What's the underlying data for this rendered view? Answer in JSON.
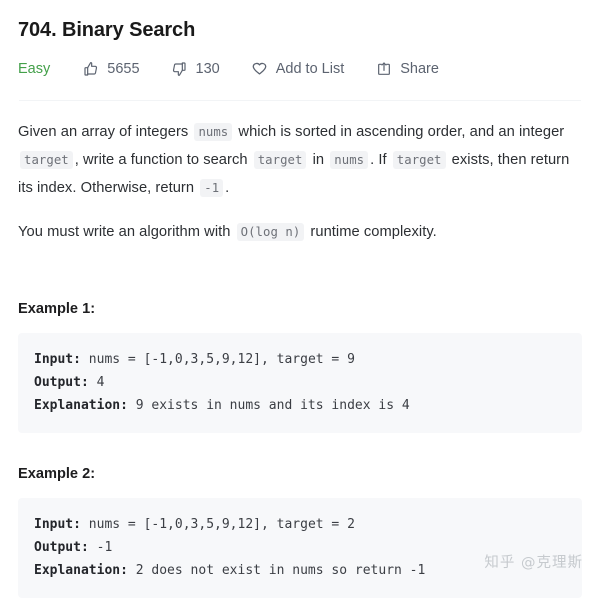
{
  "problem": {
    "title": "704. Binary Search",
    "difficulty": "Easy",
    "difficulty_color": "#44a04a"
  },
  "actions": [
    {
      "icon": "thumbs-up-icon",
      "label": "5655"
    },
    {
      "icon": "thumbs-down-icon",
      "label": "130"
    },
    {
      "icon": "heart-icon",
      "label": "Add to List"
    },
    {
      "icon": "share-icon",
      "label": "Share"
    }
  ],
  "description": {
    "p1": {
      "t1": "Given an array of integers",
      "c1": "nums",
      "t2": "which is sorted in ascending order, and an integer",
      "c2": "target",
      "t3": ", write a function to search",
      "c3": "target",
      "t4": "in",
      "c4": "nums",
      "t5": ". If",
      "c5": "target",
      "t6": "exists, then return its index. Otherwise, return",
      "c6": "-1",
      "t7": "."
    },
    "p2": {
      "t1": "You must write an algorithm with",
      "c1": "O(log n)",
      "t2": "runtime complexity."
    }
  },
  "examples": [
    {
      "heading": "Example 1:",
      "input_label": "Input:",
      "input_value": " nums = [-1,0,3,5,9,12], target = 9",
      "output_label": "Output:",
      "output_value": " 4",
      "explanation_label": "Explanation:",
      "explanation_value": " 9 exists in nums and its index is 4"
    },
    {
      "heading": "Example 2:",
      "input_label": "Input:",
      "input_value": " nums = [-1,0,3,5,9,12], target = 2",
      "output_label": "Output:",
      "output_value": " -1",
      "explanation_label": "Explanation:",
      "explanation_value": " 2 does not exist in nums so return -1"
    }
  ],
  "watermark": {
    "text": "知乎 @克理斯"
  }
}
